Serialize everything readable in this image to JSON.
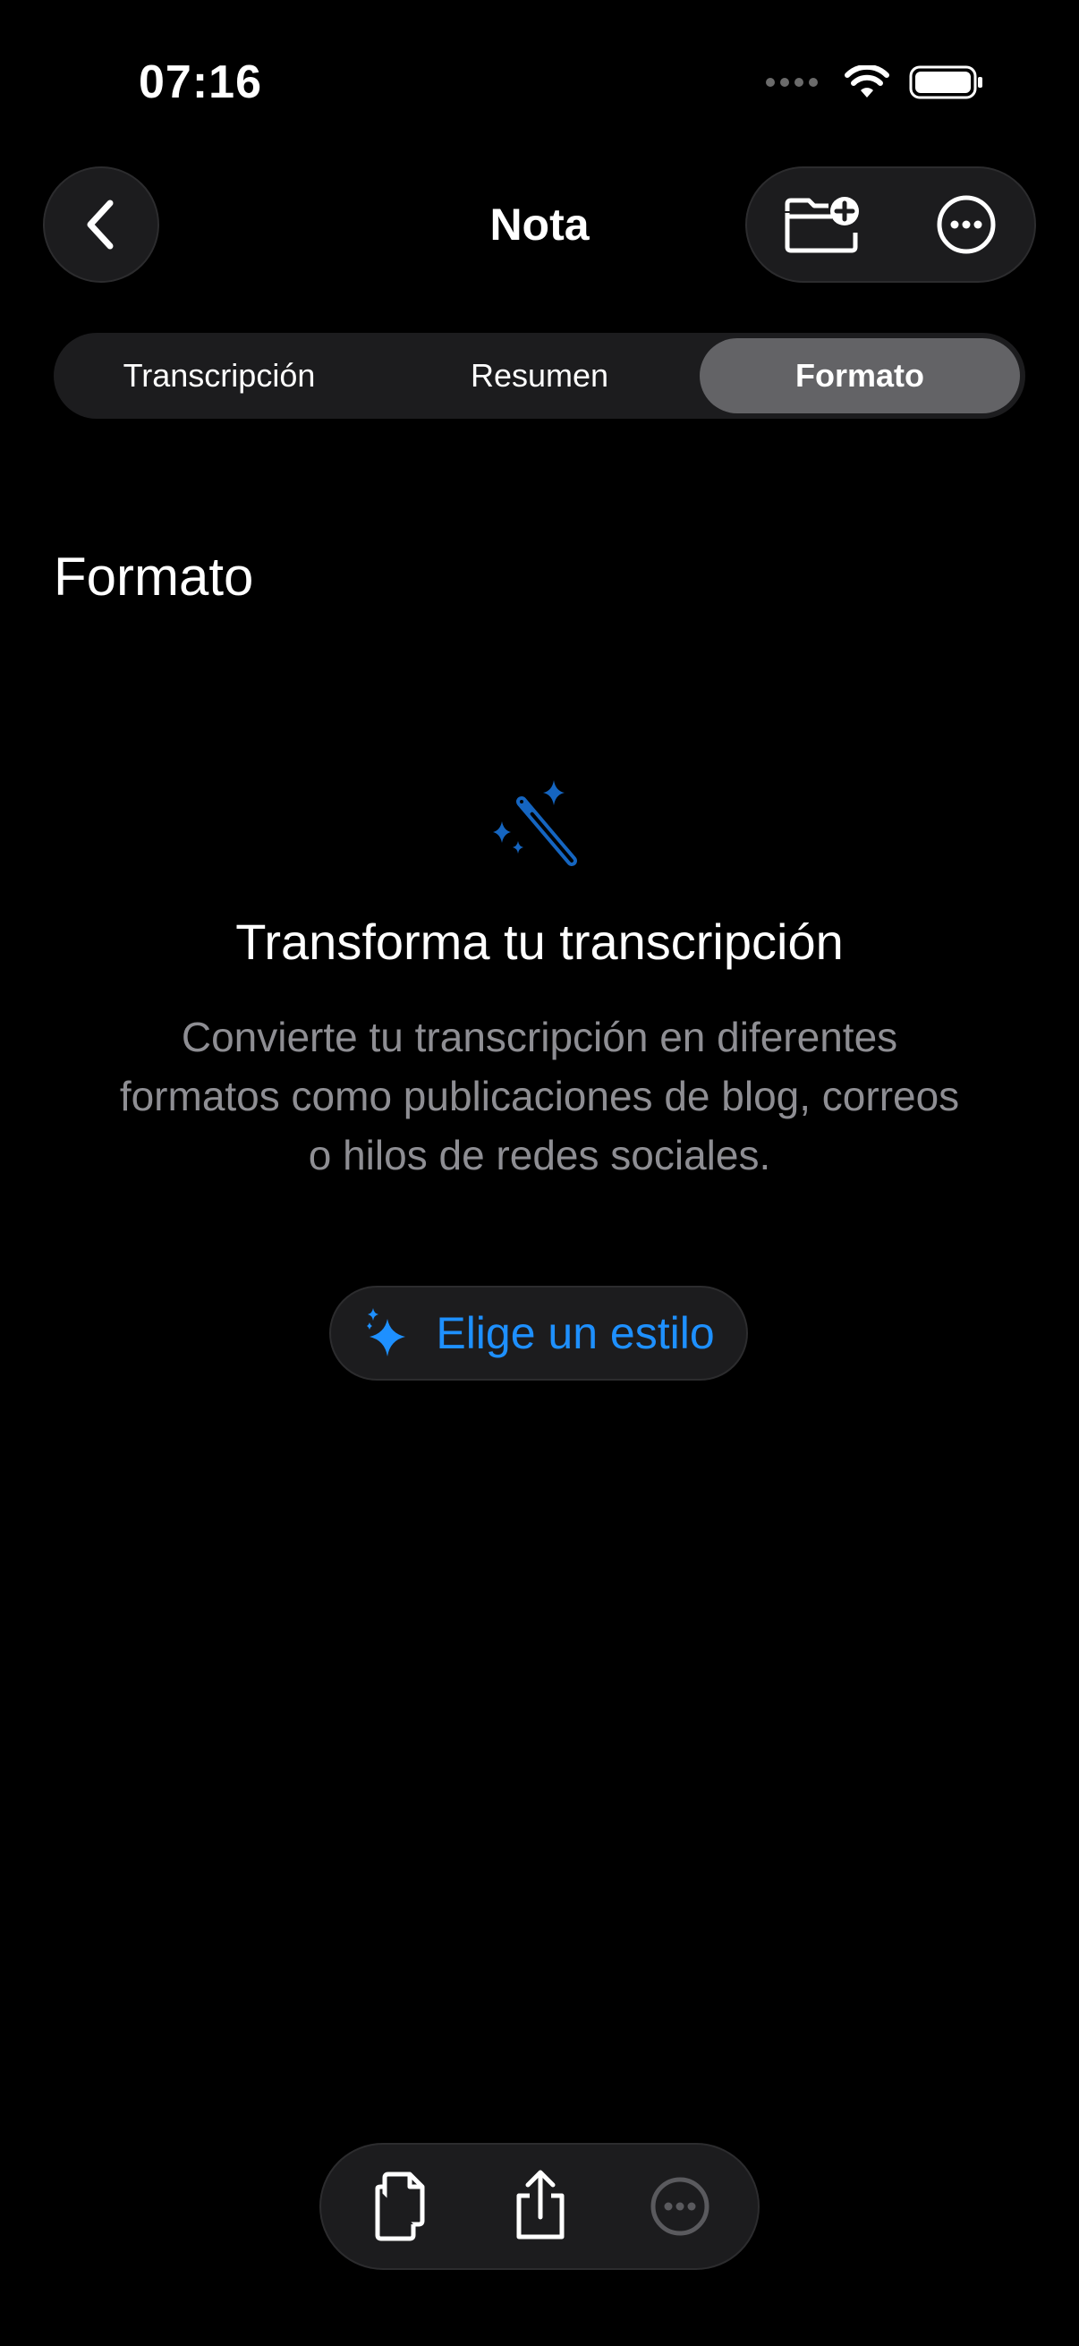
{
  "status_bar": {
    "time": "07:16",
    "icons": [
      "signal-dots-icon",
      "wifi-icon",
      "battery-icon"
    ]
  },
  "nav": {
    "title": "Nota",
    "back_icon": "chevron-left-icon",
    "actions": [
      "folder-add-icon",
      "more-circle-icon"
    ]
  },
  "tabs": [
    {
      "label": "Transcripción",
      "active": false
    },
    {
      "label": "Resumen",
      "active": false
    },
    {
      "label": "Formato",
      "active": true
    }
  ],
  "section": {
    "title": "Formato"
  },
  "empty_state": {
    "icon": "magic-wand-icon",
    "title": "Transforma tu transcripción",
    "description": "Convierte tu transcripción en diferentes formatos como publicaciones de blog, correos o hilos de redes sociales.",
    "button_label": "Elige un estilo",
    "button_icon": "sparkles-icon"
  },
  "bottom_toolbar": {
    "items": [
      "copy-icon",
      "share-icon",
      "more-circle-icon"
    ]
  },
  "colors": {
    "accent": "#1E90FF",
    "accent_dark": "#1565C0",
    "background": "#000000",
    "surface": "#1C1C1E",
    "active_tab": "#636366",
    "secondary_text": "#8E8E93"
  }
}
